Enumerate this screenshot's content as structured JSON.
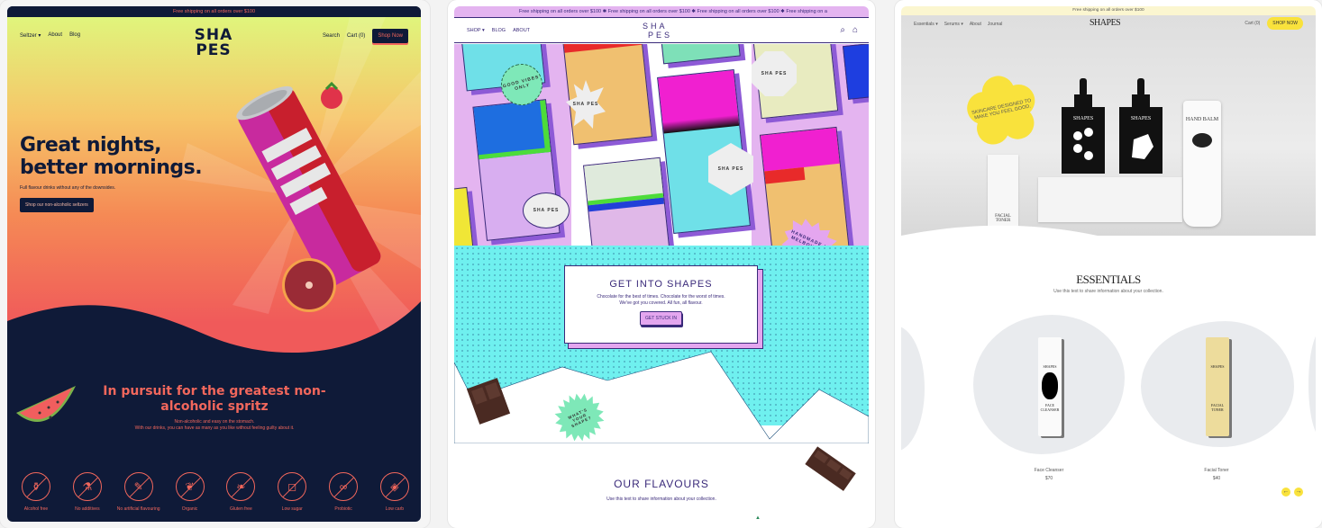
{
  "panel_1": {
    "announcement": "Free shipping on all orders over $100",
    "nav_left": [
      "Seltzer",
      "About",
      "Blog"
    ],
    "nav_dropdown_indicator": "chevron-down-icon",
    "logo": [
      "SHA",
      "PES"
    ],
    "nav_right": [
      "Search",
      "Cart (0)"
    ],
    "shop_now": "Shop Now",
    "hero_title_line1": "Great nights,",
    "hero_title_line2": "better mornings.",
    "hero_subtitle": "Full flavour drinks without any of the downsides.",
    "hero_cta": "Shop our non-alcoholic seltzers",
    "section_title": "In pursuit for the greatest non-alcoholic spritz",
    "section_body_line1": "Non-alcoholic and easy on the stomach.",
    "section_body_line2": "With our drinks, you can have as many as you like without feeling guilty about it.",
    "features": [
      {
        "label": "Alcohol free",
        "icon": "bottle-icon"
      },
      {
        "label": "No additives",
        "icon": "flask-icon"
      },
      {
        "label": "No artificial flavouring",
        "icon": "dropper-icon"
      },
      {
        "label": "Organic",
        "icon": "leaf-icon"
      },
      {
        "label": "Gluten free",
        "icon": "wheat-icon"
      },
      {
        "label": "Low sugar",
        "icon": "sugar-cube-icon"
      },
      {
        "label": "Probiotic",
        "icon": "bacteria-icon"
      },
      {
        "label": "Low carb",
        "icon": "bread-icon"
      }
    ],
    "colors": {
      "navy": "#0f1a38",
      "coral": "#f2675c",
      "lime": "#e0f57c"
    }
  },
  "panel_2": {
    "announcement": "Free shipping on all orders over $100 ✱ Free shipping on all orders over $100 ✱ Free shipping on all orders over $100 ✱ Free shipping on a",
    "nav_left": [
      "SHOP",
      "BLOG",
      "ABOUT"
    ],
    "logo": [
      "SHA",
      "PES"
    ],
    "collage_badges": [
      "GOOD VIBES ONLY",
      "SHA PES",
      "SHA PES",
      "SHA PES",
      "SHA PES",
      "HANDMADE IN MELBOURNE"
    ],
    "box_title": "GET INTO SHAPES",
    "box_text_line1": "Chocolate for the best of times. Chocolate for the worst of times.",
    "box_text_line2": "We've got you covered. All fun, all flavour.",
    "box_button": "GET STUCK IN",
    "starburst": "WHAT'S YOUR SHAPE?",
    "section_title": "OUR FLAVOURS",
    "section_subtitle": "Use this text to share information about your collection.",
    "colors": {
      "purple": "#3a2a7a",
      "lilac": "#e4a6ef",
      "cyan": "#6ff0ef"
    }
  },
  "panel_3": {
    "announcement": "Free shipping on all orders over $100",
    "nav_left": [
      "Essentials",
      "Serums",
      "About",
      "Journal"
    ],
    "logo": "SHAPES",
    "cart": "Cart (0)",
    "shop_now": "SHOP NOW",
    "hero_badge": "SKINCARE DESIGNED TO MAKE YOU FEEL GOOD.",
    "hero_products": [
      "SHAPES",
      "SHAPES",
      "HAND BALM",
      "FACIAL TONER"
    ],
    "section_title": "ESSENTIALS",
    "section_subtitle": "Use this text to share information about your collection.",
    "products": [
      {
        "name": "Face Cleanser",
        "price": "$70",
        "label": "FACE CLEANSER",
        "brand": "SHAPES"
      },
      {
        "name": "Facial Toner",
        "price": "$40",
        "label": "FACIAL TONER",
        "brand": "SHAPES"
      }
    ],
    "carousel_prev": "←",
    "carousel_next": "→",
    "colors": {
      "yellow": "#f9e23c",
      "grey_blob": "#e9ebee"
    }
  }
}
